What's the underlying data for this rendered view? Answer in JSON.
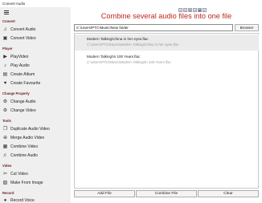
{
  "window": {
    "title": "Convert Audio"
  },
  "sidebar": {
    "sections": [
      {
        "label": "Convert",
        "items": [
          {
            "label": "Convert Audio",
            "icon": "convert-audio-icon"
          },
          {
            "label": "Convert Video",
            "icon": "convert-video-icon"
          }
        ]
      },
      {
        "label": "Player",
        "items": [
          {
            "label": "PlayVideo",
            "icon": "play-video-icon"
          },
          {
            "label": "Play Audio",
            "icon": "play-audio-icon"
          },
          {
            "label": "Create Album",
            "icon": "album-icon"
          },
          {
            "label": "Create Favourite",
            "icon": "heart-icon"
          }
        ]
      },
      {
        "label": "Change Property",
        "items": [
          {
            "label": "Change Audio",
            "icon": "change-audio-icon"
          },
          {
            "label": "Change Video",
            "icon": "change-video-icon"
          }
        ]
      },
      {
        "label": "Tools",
        "items": [
          {
            "label": "Duplicate Audio Video",
            "icon": "duplicate-icon"
          },
          {
            "label": "Merge Audio Video",
            "icon": "merge-icon"
          },
          {
            "label": "Combine Video",
            "icon": "combine-video-icon"
          },
          {
            "label": "Combine Audio",
            "icon": "combine-audio-icon"
          }
        ]
      },
      {
        "label": "Video",
        "items": [
          {
            "label": "Cut Video",
            "icon": "scissors-icon"
          },
          {
            "label": "Make From Image",
            "icon": "image-icon"
          }
        ]
      },
      {
        "label": "Record",
        "items": [
          {
            "label": "Record Voice",
            "icon": "microphone-icon"
          }
        ]
      }
    ]
  },
  "main": {
    "heading": "Combine several audio files into one file",
    "path_value": "C:\\Users\\PTC\\Music\\New folder",
    "browse_label": "Browser",
    "files": [
      {
        "name": "Modern Talking\\China in her eyes.flac",
        "path": "C:\\Users\\PTC\\Music\\Modern Talking\\China in her eyes.flac",
        "selected": true
      },
      {
        "name": "Modern Talking\\In 100 Years.flac",
        "path": "C:\\Users\\PTC\\Music\\Modern Talking\\In 100 Years.flac",
        "selected": false
      }
    ],
    "buttons": {
      "add_file": "Add File",
      "combine_file": "Combine File",
      "clear": "Clear"
    }
  }
}
